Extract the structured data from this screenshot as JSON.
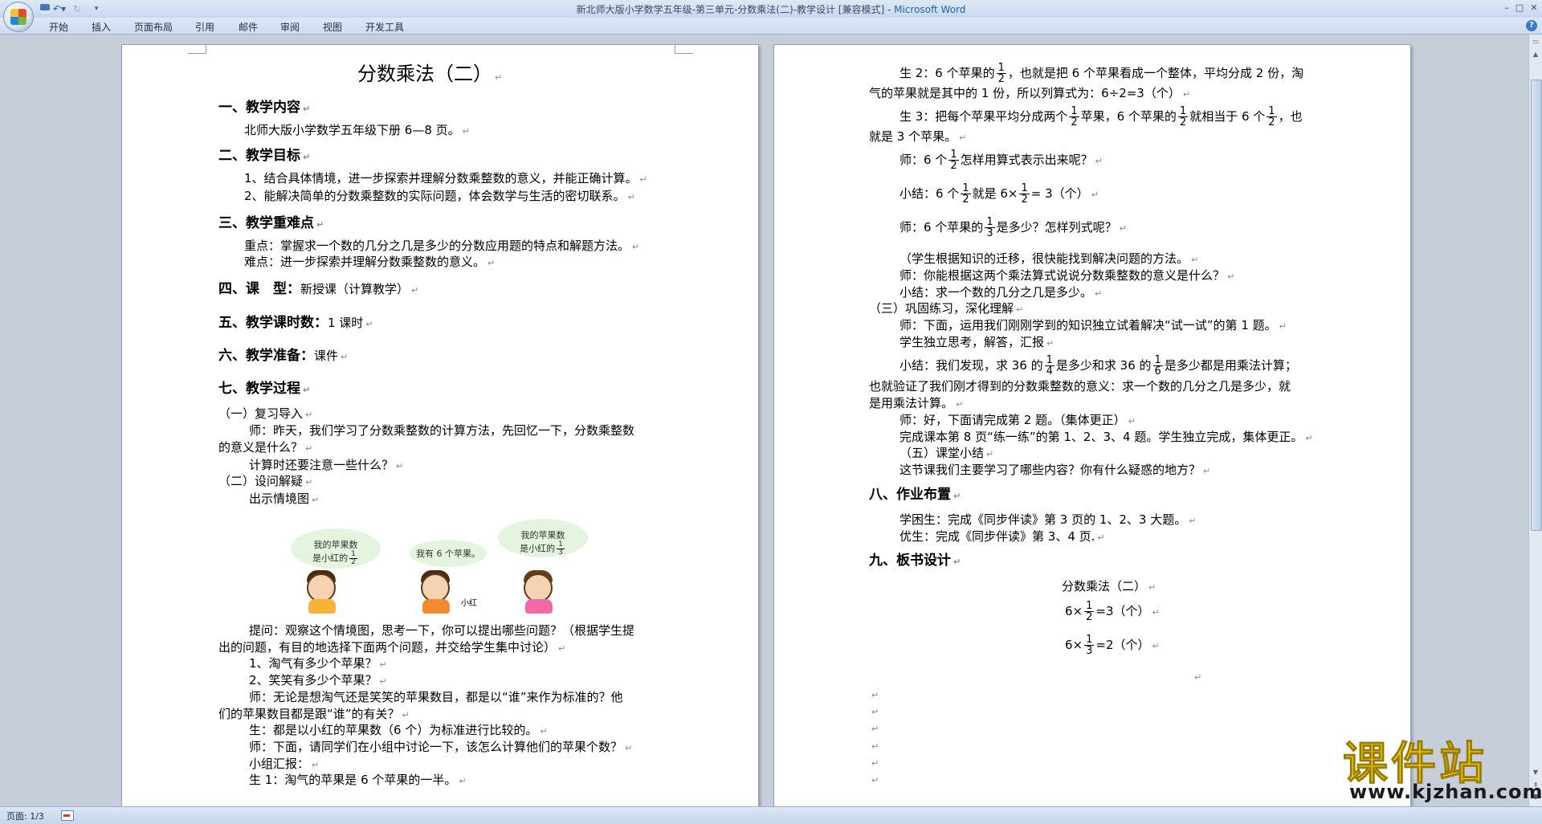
{
  "window": {
    "title_doc": "新北师大版小学数学五年级-第三单元-分数乘法(二)-教学设计 [兼容模式] - ",
    "title_app": "Microsoft Word"
  },
  "ribbon": {
    "tabs": [
      "开始",
      "插入",
      "页面布局",
      "引用",
      "邮件",
      "审阅",
      "视图",
      "开发工具"
    ]
  },
  "status": {
    "page": "页面: 1/3"
  },
  "watermark": {
    "logo": "课件站",
    "url": "www.kjzhan.com"
  },
  "colors": {
    "app_bg": "#c5ced9",
    "accent": "#2a5db0",
    "watermark": "#f2d600"
  },
  "doc": {
    "title": "分数乘法（二）",
    "h1": "一、教学内容",
    "content": "北师大版小学数学五年级下册 6—8 页。",
    "h2": "二、教学目标",
    "goal1": "1、结合具体情境，进一步探索并理解分数乘整数的意义，并能正确计算。",
    "goal2": "2、能解决简单的分数乘整数的实际问题，体会数学与生活的密切联系。",
    "h3": "三、教学重难点",
    "key": "重点：掌握求一个数的几分之几是多少的分数应用题的特点和解题方法。",
    "diff": "难点：进一步探索并理解分数乘整数的意义。",
    "h4": "四、课　型：",
    "h4v": "新授课（计算教学）",
    "h5": "五、教学课时数：",
    "h5v": "1 课时",
    "h6": "六、教学准备：",
    "h6v": "课件",
    "h7": "七、教学过程",
    "p1": "（一）复习导入",
    "p2": "师：昨天，我们学习了分数乘整数的计算方法，先回忆一下，分数乘整数",
    "p3": "的意义是什么？",
    "p4": "计算时还要注意一些什么？",
    "p5": "（二）设问解疑",
    "p6": "出示情境图",
    "bubble1a": "我的苹果数",
    "bubble1b": "是小红的",
    "bubble2": "我有 6 个苹果。",
    "bubble3a": "我的苹果数",
    "bubble3b": "是小红的",
    "kid_name": "小红",
    "q1": "提问：观察这个情境图，思考一下，你可以提出哪些问题？（根据学生提",
    "q2": "出的问题，有目的地选择下面两个问题，并交给学生集中讨论）",
    "q3": "1、淘气有多少个苹果？",
    "q4": "2、笑笑有多少个苹果？",
    "q5": "师：无论是想淘气还是笑笑的苹果数目，都是以“谁”来作为标准的？他",
    "q6": "们的苹果数目都是跟“谁”的有关？",
    "q7": "生：都是以小红的苹果数（6 个）为标准进行比较的。",
    "q8": "师：下面，请同学们在小组中讨论一下，该怎么计算他们的苹果个数？",
    "q9": "小组汇报：",
    "q10": "生 1：淘气的苹果是 6 个苹果的一半。",
    "r1a": "生 2：6 个苹果的",
    "r1b": "，也就是把 6 个苹果看成一个整体，平均分成 2 份，淘",
    "r2": "气的苹果就是其中的 1 份，所以列算式为：6÷2=3（个）",
    "r3a": "生 3：把每个苹果平均分成两个",
    "r3b": "苹果，6 个苹果的",
    "r3c": "就相当于 6 个",
    "r3d": "，也",
    "r4": "就是 3 个苹果。",
    "r5a": "师：6 个",
    "r5b": "怎样用算式表示出来呢？",
    "r6a": "小结：6 个",
    "r6b": "就是 6×",
    "r6c": "= 3（个）",
    "r7a": "师：6 个苹果的",
    "r7b": "是多少？怎样列式呢？",
    "r8": "（学生根据知识的迁移，很快能找到解决问题的方法。",
    "r9": "师：你能根据这两个乘法算式说说分数乘整数的意义是什么？",
    "r10": "小结：求一个数的几分之几是多少。",
    "r11": "（三）巩固练习，深化理解",
    "r12": "师：下面，运用我们刚刚学到的知识独立试着解决“试一试”的第 1 题。",
    "r13": "学生独立思考，解答，汇报",
    "r14a": "小结：我们发现，求 36 的",
    "r14b": "是多少和求 36 的",
    "r14c": "是多少都是用乘法计算；",
    "r15": "也就验证了我们刚才得到的分数乘整数的意义：求一个数的几分之几是多少，就",
    "r16": "是用乘法计算。",
    "r17": "师：好，下面请完成第 2 题。（集体更正）",
    "r18": "完成课本第 8 页“练一练”的第 1、2、3、4 题。学生独立完成，集体更正。",
    "r19": "（五）课堂小结",
    "r20": "这节课我们主要学习了哪些内容？你有什么疑惑的地方？",
    "h8": "八、作业布置",
    "hw1": "学困生：完成《同步伴读》第 3 页的 1、2、3 大题。",
    "hw2": "优生：完成《同步伴读》第 3、4 页.",
    "h9": "九、板书设计",
    "b1": "分数乘法（二）",
    "b2a": "6×",
    "b2b": "=3（个）",
    "b3a": "6×",
    "b3b": "=2（个）",
    "f_n1": "1",
    "f_d2": "2",
    "f_d3": "3",
    "f_d4": "4",
    "f_d6": "6"
  }
}
